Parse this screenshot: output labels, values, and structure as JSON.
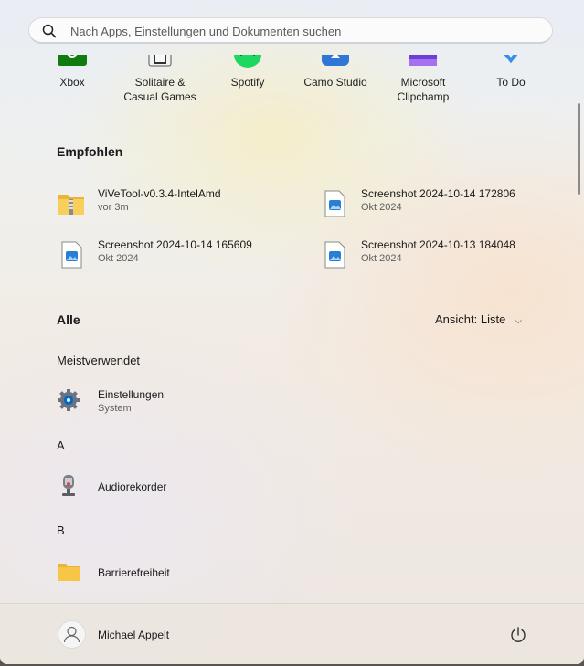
{
  "search": {
    "placeholder": "Nach Apps, Einstellungen und Dokumenten suchen"
  },
  "pinned": [
    {
      "label": "Xbox",
      "icon": "xbox-icon"
    },
    {
      "label": "Solitaire &\nCasual Games",
      "line1": "Solitaire &",
      "line2": "Casual Games",
      "icon": "solitaire-icon"
    },
    {
      "label": "Spotify",
      "icon": "spotify-icon"
    },
    {
      "label": "Camo Studio",
      "icon": "camo-icon"
    },
    {
      "line1": "Microsoft",
      "line2": "Clipchamp",
      "icon": "clipchamp-icon"
    },
    {
      "label": "To Do",
      "icon": "todo-icon"
    }
  ],
  "recommended": {
    "title": "Empfohlen",
    "items": [
      {
        "name": "ViVeTool-v0.3.4-IntelAmd",
        "sub": "vor 3m",
        "icon": "zip-folder-icon"
      },
      {
        "name": "Screenshot 2024-10-14 172806",
        "sub": "Okt 2024",
        "icon": "image-file-icon"
      },
      {
        "name": "Screenshot 2024-10-14 165609",
        "sub": "Okt 2024",
        "icon": "image-file-icon"
      },
      {
        "name": "Screenshot 2024-10-13 184048",
        "sub": "Okt 2024",
        "icon": "image-file-icon"
      }
    ]
  },
  "all": {
    "title": "Alle",
    "view_label": "Ansicht: Liste",
    "groups": [
      {
        "label": "Meistverwendet"
      },
      {
        "label": "A"
      },
      {
        "label": "B"
      }
    ],
    "apps": [
      {
        "name": "Einstellungen",
        "sub": "System",
        "icon": "settings-gear-icon"
      },
      {
        "name": "Audiorekorder",
        "icon": "microphone-icon"
      },
      {
        "name": "Barrierefreiheit",
        "icon": "folder-icon"
      }
    ]
  },
  "footer": {
    "user_name": "Michael Appelt"
  },
  "colors": {
    "accent": "#0067c0",
    "folder": "#f7c646"
  }
}
